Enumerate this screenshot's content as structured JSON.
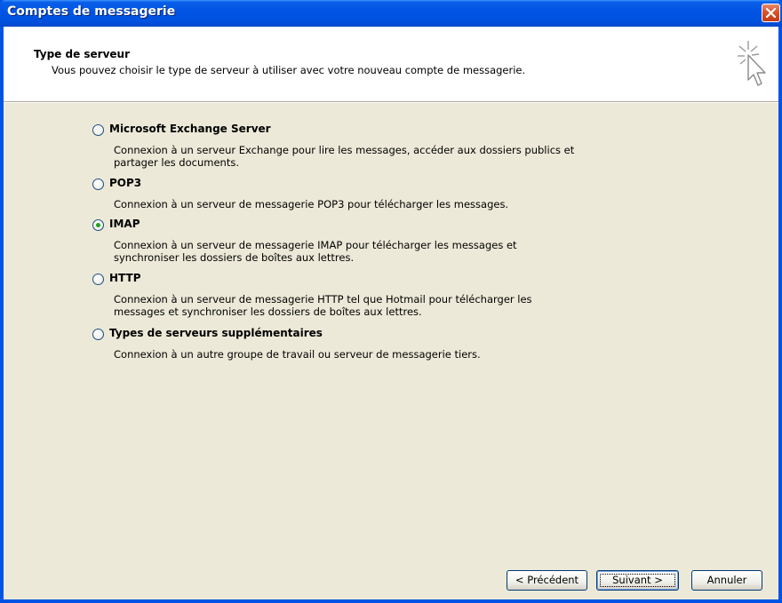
{
  "window": {
    "title": "Comptes de messagerie",
    "accent_color": "#0054e3",
    "close_icon": "close-icon"
  },
  "header": {
    "title": "Type de serveur",
    "subtitle": "Vous pouvez choisir le type de serveur à utiliser avec votre nouveau compte de messagerie.",
    "icon": "wizard-cursor-icon"
  },
  "options": [
    {
      "label": "Microsoft Exchange Server",
      "description": "Connexion à un serveur Exchange pour lire les messages, accéder aux dossiers publics et partager les documents.",
      "checked": false
    },
    {
      "label": "POP3",
      "description": "Connexion à un serveur de messagerie POP3 pour télécharger les messages.",
      "checked": false
    },
    {
      "label": "IMAP",
      "description": "Connexion à un serveur de messagerie IMAP pour télécharger les messages et synchroniser les dossiers de boîtes aux lettres.",
      "checked": true
    },
    {
      "label": "HTTP",
      "description": "Connexion à un serveur de messagerie HTTP tel que Hotmail pour télécharger les messages et synchroniser les dossiers de boîtes aux lettres.",
      "checked": false
    },
    {
      "label": "Types de serveurs supplémentaires",
      "description": "Connexion à un autre groupe de travail ou serveur de messagerie tiers.",
      "checked": false
    }
  ],
  "buttons": {
    "back_label": "< Précédent",
    "next_label": "Suivant >",
    "cancel_label": "Annuler"
  }
}
